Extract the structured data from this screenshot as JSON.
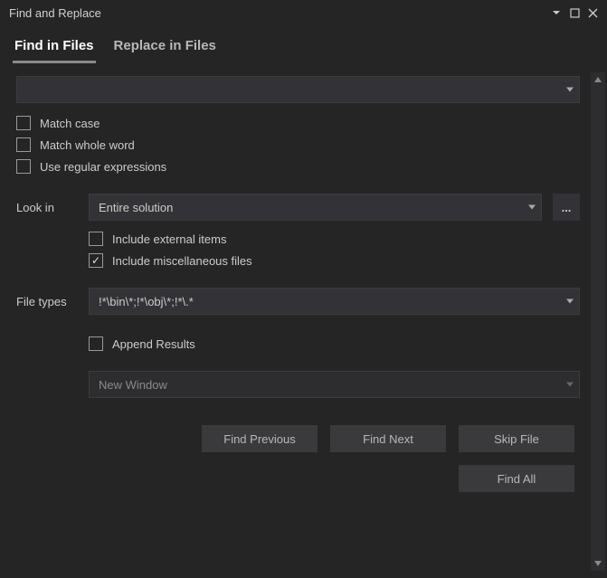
{
  "window": {
    "title": "Find and Replace"
  },
  "tabs": {
    "find": "Find in Files",
    "replace": "Replace in Files"
  },
  "search": {
    "value": ""
  },
  "options": {
    "match_case": "Match case",
    "match_whole_word": "Match whole word",
    "use_regex": "Use regular expressions"
  },
  "look_in": {
    "label": "Look in",
    "value": "Entire solution",
    "browse": "..."
  },
  "look_in_options": {
    "include_external": "Include external items",
    "include_misc": "Include miscellaneous files"
  },
  "file_types": {
    "label": "File types",
    "value": "!*\\bin\\*;!*\\obj\\*;!*\\.*"
  },
  "results": {
    "append": "Append Results",
    "target": "New Window"
  },
  "buttons": {
    "find_prev": "Find Previous",
    "find_next": "Find Next",
    "skip_file": "Skip File",
    "find_all": "Find All"
  }
}
